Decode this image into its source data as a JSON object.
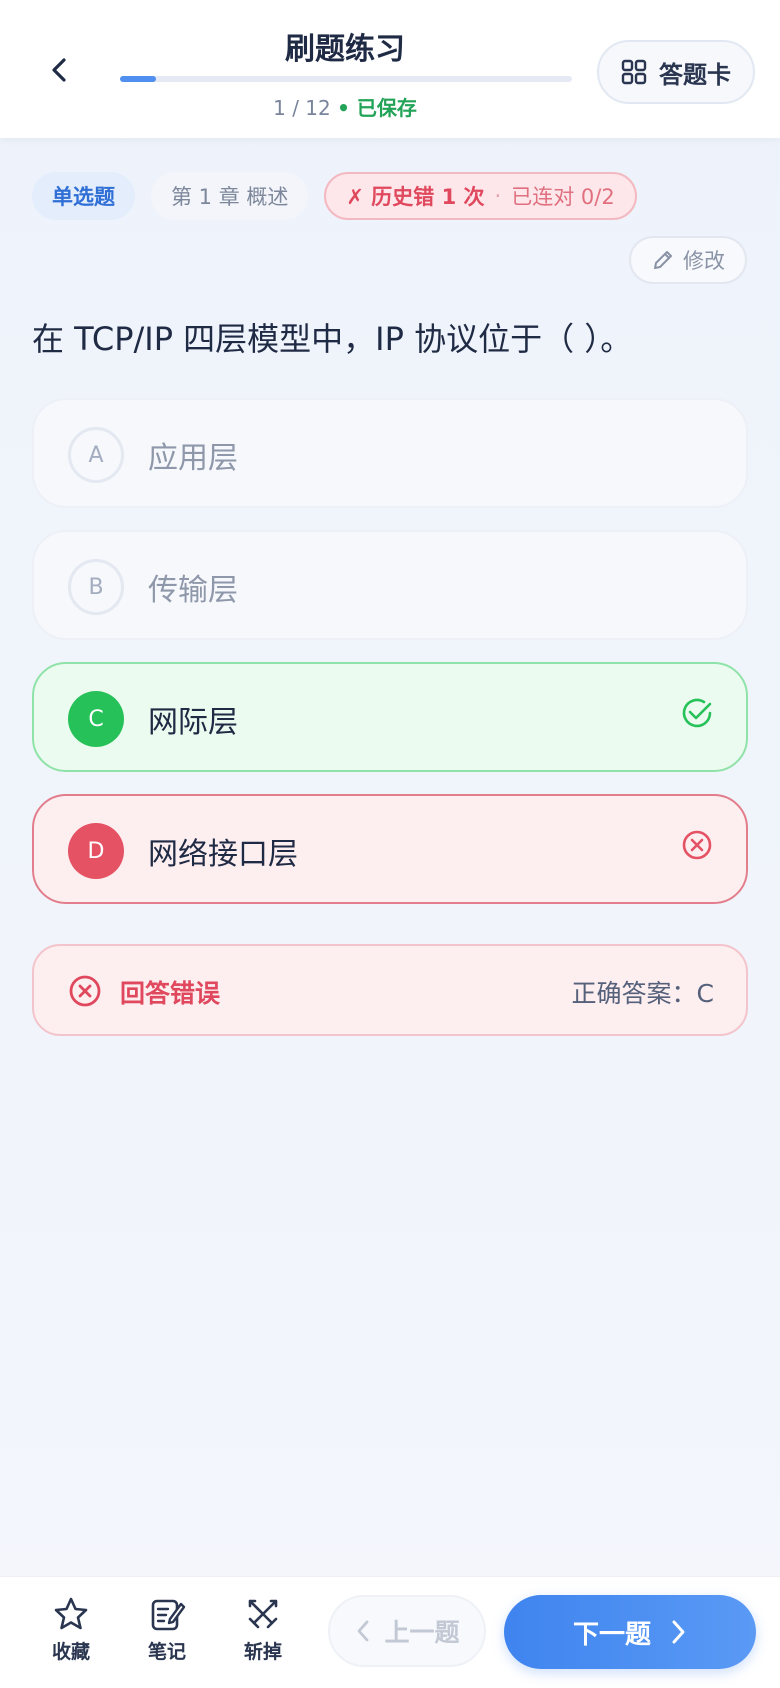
{
  "header": {
    "title": "刷题练习",
    "progress_value": 0.08,
    "progress_text": "1 / 12",
    "saved_label": "• 已保存",
    "answer_card_label": "答题卡"
  },
  "tags": {
    "type": "单选题",
    "chapter": "第 1 章 概述",
    "history_wrong": "✗ 历史错 1 次",
    "dot": "·",
    "streak": "已连对 0/2"
  },
  "edit_label": "修改",
  "question": "在 TCP/IP 四层模型中，IP 协议位于（ ）。",
  "options": [
    {
      "letter": "A",
      "text": "应用层",
      "state": "neutral"
    },
    {
      "letter": "B",
      "text": "传输层",
      "state": "neutral"
    },
    {
      "letter": "C",
      "text": "网际层",
      "state": "correct"
    },
    {
      "letter": "D",
      "text": "网络接口层",
      "state": "wrong"
    }
  ],
  "result": {
    "status": "回答错误",
    "correct_answer": "正确答案：C"
  },
  "bottom": {
    "favorite": "收藏",
    "note": "笔记",
    "remove": "斩掉",
    "prev": "上一题",
    "next": "下一题"
  },
  "colors": {
    "accent": "#4f8ff0",
    "correct": "#27c15a",
    "wrong": "#e45264"
  }
}
